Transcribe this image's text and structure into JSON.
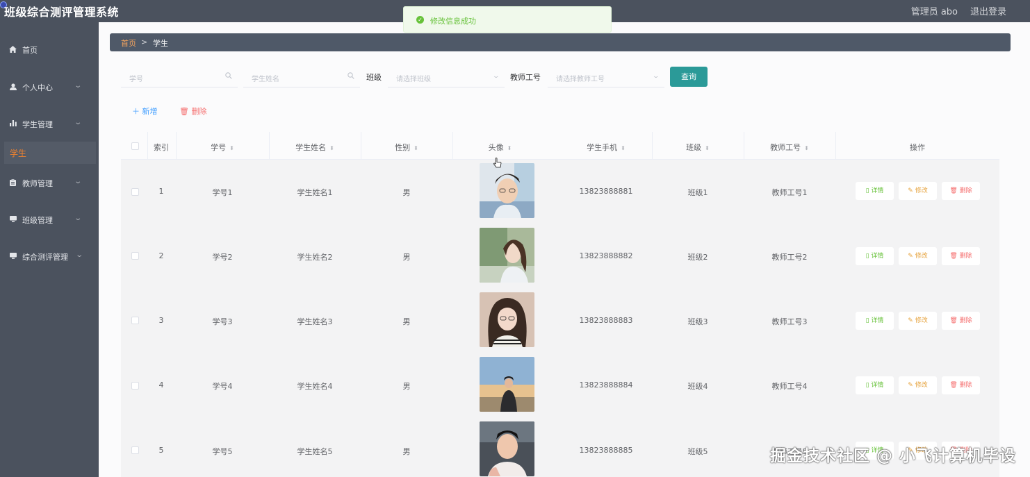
{
  "app": {
    "title": "班级综合测评管理系统",
    "admin_label": "管理员 abo",
    "logout_label": "退出登录"
  },
  "toast": {
    "message": "修改信息成功"
  },
  "sidebar": {
    "items": [
      {
        "label": "首页",
        "icon": "home-icon"
      },
      {
        "label": "个人中心",
        "icon": "user-icon"
      },
      {
        "label": "学生管理",
        "icon": "bar-chart-icon"
      },
      {
        "label": "教师管理",
        "icon": "clipboard-icon"
      },
      {
        "label": "班级管理",
        "icon": "monitor-icon"
      },
      {
        "label": "综合测评管理",
        "icon": "monitor-icon"
      }
    ],
    "active_sub": "学生"
  },
  "breadcrumb": {
    "home": "首页",
    "separator": ">",
    "current": "学生"
  },
  "search": {
    "student_no_placeholder": "学号",
    "student_name_placeholder": "学生姓名",
    "class_label": "班级",
    "class_placeholder": "请选择班级",
    "teacher_label": "教师工号",
    "teacher_placeholder": "请选择教师工号",
    "search_button": "查询"
  },
  "actions": {
    "add": "新增",
    "delete": "删除"
  },
  "table": {
    "headers": [
      "索引",
      "学号",
      "学生姓名",
      "性别",
      "头像",
      "学生手机",
      "班级",
      "教师工号",
      "操作"
    ],
    "op_labels": {
      "detail": "详情",
      "edit": "修改",
      "delete": "删除"
    },
    "rows": [
      {
        "index": "1",
        "student_no": "学号1",
        "name": "学生姓名1",
        "gender": "男",
        "phone": "13823888881",
        "class": "班级1",
        "teacher_no": "教师工号1"
      },
      {
        "index": "2",
        "student_no": "学号2",
        "name": "学生姓名2",
        "gender": "男",
        "phone": "13823888882",
        "class": "班级2",
        "teacher_no": "教师工号2"
      },
      {
        "index": "3",
        "student_no": "学号3",
        "name": "学生姓名3",
        "gender": "男",
        "phone": "13823888883",
        "class": "班级3",
        "teacher_no": "教师工号3"
      },
      {
        "index": "4",
        "student_no": "学号4",
        "name": "学生姓名4",
        "gender": "男",
        "phone": "13823888884",
        "class": "班级4",
        "teacher_no": "教师工号4"
      },
      {
        "index": "5",
        "student_no": "学号5",
        "name": "学生姓名5",
        "gender": "男",
        "phone": "13823888885",
        "class": "班级5",
        "teacher_no": "教师工号5"
      }
    ]
  },
  "watermark": "掘金技术社区 @ 小飞计算机毕设"
}
